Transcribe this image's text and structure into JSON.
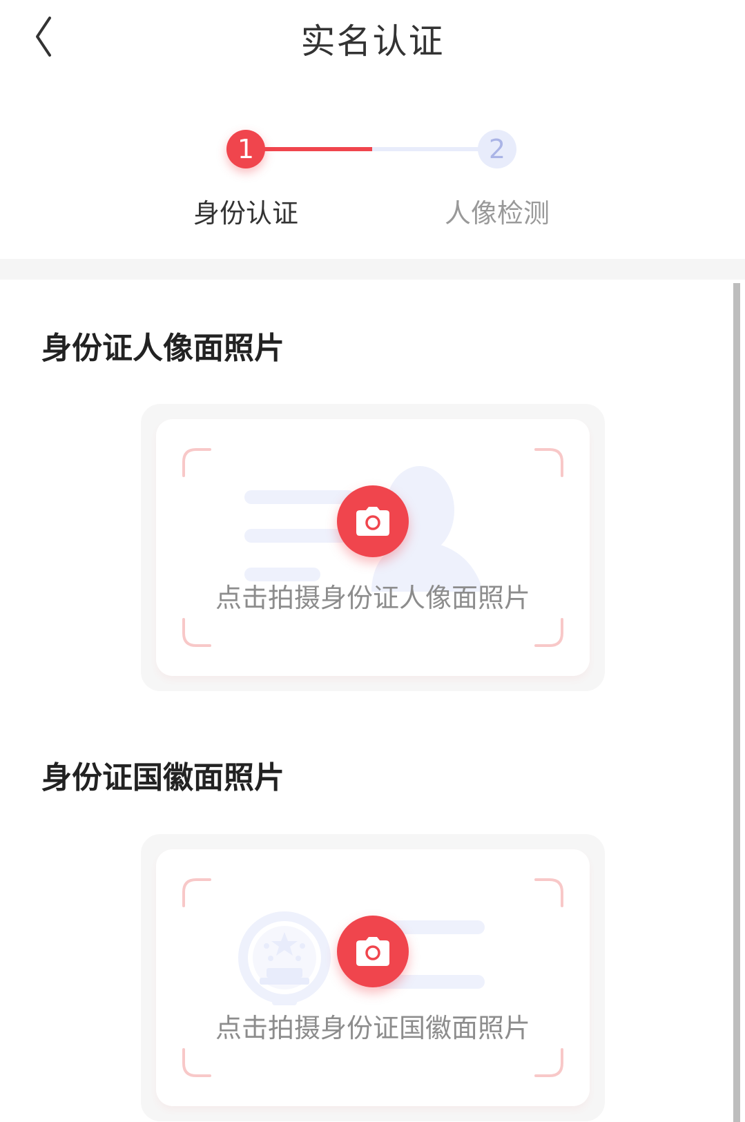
{
  "header": {
    "title": "实名认证"
  },
  "stepper": {
    "steps": [
      {
        "number": "1",
        "label": "身份认证"
      },
      {
        "number": "2",
        "label": "人像检测"
      }
    ]
  },
  "sections": [
    {
      "title": "身份证人像面照片",
      "hint": "点击拍摄身份证人像面照片"
    },
    {
      "title": "身份证国徽面照片",
      "hint": "点击拍摄身份证国徽面照片"
    }
  ],
  "colors": {
    "accent": "#f0454d",
    "step_inactive": "#e8ecfb",
    "illustration": "#eef1fc"
  }
}
